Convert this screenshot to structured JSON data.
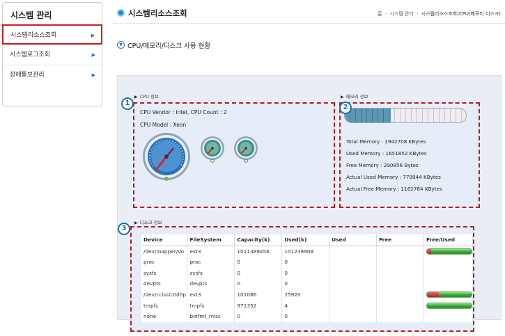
{
  "sidebar": {
    "title": "시스템 관리",
    "items": [
      {
        "label": "시스템리소스조회",
        "active": true
      },
      {
        "label": "시스템로그조회",
        "active": false
      },
      {
        "label": "장애통보관리",
        "active": false
      }
    ],
    "arrow_glyph": "▶"
  },
  "header": {
    "title": "시스템리소스조회",
    "breadcrumb": [
      "홈",
      "시스템 관리",
      "시스템리소스조회(CPU/메모리 디스크)"
    ],
    "breadcrumb_sep": "›"
  },
  "section": {
    "title": "CPU/메모리/디스크 사용 현황",
    "icon": "chevron-down-circle-icon"
  },
  "cpu": {
    "label": "CPU 정보",
    "badge": "1",
    "vendor_line": "CPU Vendor : Intel, CPU Count : 2",
    "model_line": "CPU Model : Xeon"
  },
  "memory": {
    "label": "메모리 정보",
    "badge": "2",
    "used_fraction": 0.38,
    "lines": [
      "Total Memory : 1942708 KBytes",
      "Used Memory : 1651852 KBytes",
      "Free Memory : 290856 Bytes",
      "Actual Used Memory : 779944 KBytes",
      "Actual Free Memory : 1162764 KBytes"
    ]
  },
  "disk": {
    "label": "디스크 정보",
    "badge": "3",
    "columns": [
      "Device",
      "FileSystem",
      "Capacity(k)",
      "Used(k)",
      "Used",
      "Free",
      "Free/Used"
    ],
    "rows": [
      {
        "device": "/dev/mapper/Vo",
        "fs": "ext3",
        "capacity": "1011389456",
        "used_k": "101239908",
        "bar": true,
        "used_fraction": 0.1
      },
      {
        "device": "proc",
        "fs": "proc",
        "capacity": "0",
        "used_k": "0",
        "bar": false
      },
      {
        "device": "sysfs",
        "fs": "sysfs",
        "capacity": "0",
        "used_k": "0",
        "bar": false
      },
      {
        "device": "devpts",
        "fs": "devpts",
        "capacity": "0",
        "used_k": "0",
        "bar": false
      },
      {
        "device": "/dev/cciss/c0d0p",
        "fs": "ext3",
        "capacity": "101086",
        "used_k": "25920",
        "bar": true,
        "used_fraction": 0.26
      },
      {
        "device": "tmpfs",
        "fs": "tmpfs",
        "capacity": "971352",
        "used_k": "4",
        "bar": true,
        "used_fraction": 0.0
      },
      {
        "device": "none",
        "fs": "binfmt_misc",
        "capacity": "0",
        "used_k": "0",
        "bar": false
      }
    ]
  },
  "colors": {
    "accent": "#1a8fc9",
    "highlight_border": "#cc1f1f",
    "bar_used": "#c0392b",
    "bar_free": "#3aa83a",
    "memory_fill": "#4a82a4"
  }
}
